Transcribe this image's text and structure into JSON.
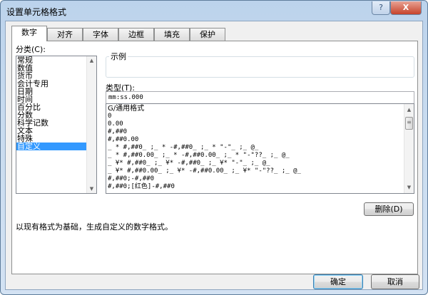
{
  "window": {
    "title": "设置单元格格式",
    "help": "?",
    "close": "X"
  },
  "tabs": [
    "数字",
    "对齐",
    "字体",
    "边框",
    "填充",
    "保护"
  ],
  "category": {
    "label": "分类(C):",
    "items": [
      "常规",
      "数值",
      "货币",
      "会计专用",
      "日期",
      "时间",
      "百分比",
      "分数",
      "科学记数",
      "文本",
      "特殊",
      "自定义"
    ],
    "selected": "自定义"
  },
  "sample": {
    "label": "示例",
    "value": ""
  },
  "type": {
    "label": "类型(T):",
    "value": "mm:ss.000",
    "formats": [
      "G/通用格式",
      "0",
      "0.00",
      "#,##0",
      "#,##0.00",
      "_ * #,##0_ ;_ * -#,##0_ ;_ * \"-\"_ ;_ @_",
      "_ * #,##0.00_ ;_ * -#,##0.00_ ;_ * \"-\"??_ ;_ @_",
      "_ ¥* #,##0_ ;_ ¥* -#,##0_ ;_ ¥* \"-\"_ ;_ @_",
      "_ ¥* #,##0.00_ ;_ ¥* -#,##0.00_ ;_ ¥* \"-\"??_ ;_ @_",
      "#,##0;-#,##0",
      "#,##0;[红色]-#,##0"
    ]
  },
  "delete_label": "删除(D)",
  "description": "以现有格式为基础，生成自定义的数字格式。",
  "ok_label": "确定",
  "cancel_label": "取消"
}
